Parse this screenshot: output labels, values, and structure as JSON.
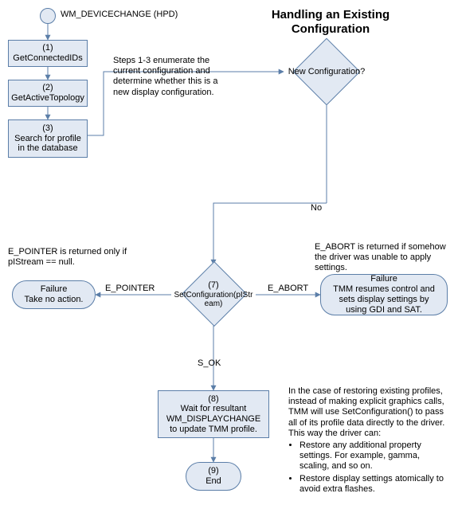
{
  "chart_data": {
    "type": "flowchart",
    "title": "Handling an Existing Configuration",
    "start": {
      "label": "WM_DEVICECHANGE (HPD)"
    },
    "nodes": {
      "step1": {
        "num": "(1)",
        "label": "GetConnectedIDs"
      },
      "step2": {
        "num": "(2)",
        "label": "GetActiveTopology"
      },
      "step3": {
        "num": "(3)",
        "label": "Search for profile in the database"
      },
      "decision_new": {
        "label": "New Configuration?"
      },
      "decision_setcfg": {
        "num": "(7)",
        "label": "SetConfiguration(pIStream)"
      },
      "failure_left": {
        "label": "Failure\nTake no action."
      },
      "failure_right": {
        "label": "Failure\nTMM resumes control and sets display settings by using GDI and SAT."
      },
      "step8": {
        "num": "(8)",
        "label": "Wait for resultant WM_DISPLAYCHANGE to update TMM profile."
      },
      "step9": {
        "num": "(9)",
        "label": "End"
      }
    },
    "edges": {
      "new_to_setcfg": "No",
      "setcfg_left": "E_POINTER",
      "setcfg_right": "E_ABORT",
      "setcfg_down": "S_OK"
    },
    "annotations": {
      "enum_note": "Steps 1-3 enumerate the current configuration and determine whether this is a new display configuration.",
      "epointer_note": "E_POINTER is returned only if pIStream == null.",
      "eabort_note": "E_ABORT is returned if somehow the driver was unable to apply settings.",
      "restore_note_intro": "In the case of restoring existing profiles, instead of making explicit graphics calls, TMM will use SetConfiguration() to pass all of its profile data directly to the driver. This way the driver can:",
      "restore_bullet1": "Restore any additional property settings. For example, gamma, scaling, and so on.",
      "restore_bullet2": "Restore display settings atomically to avoid extra flashes."
    }
  }
}
